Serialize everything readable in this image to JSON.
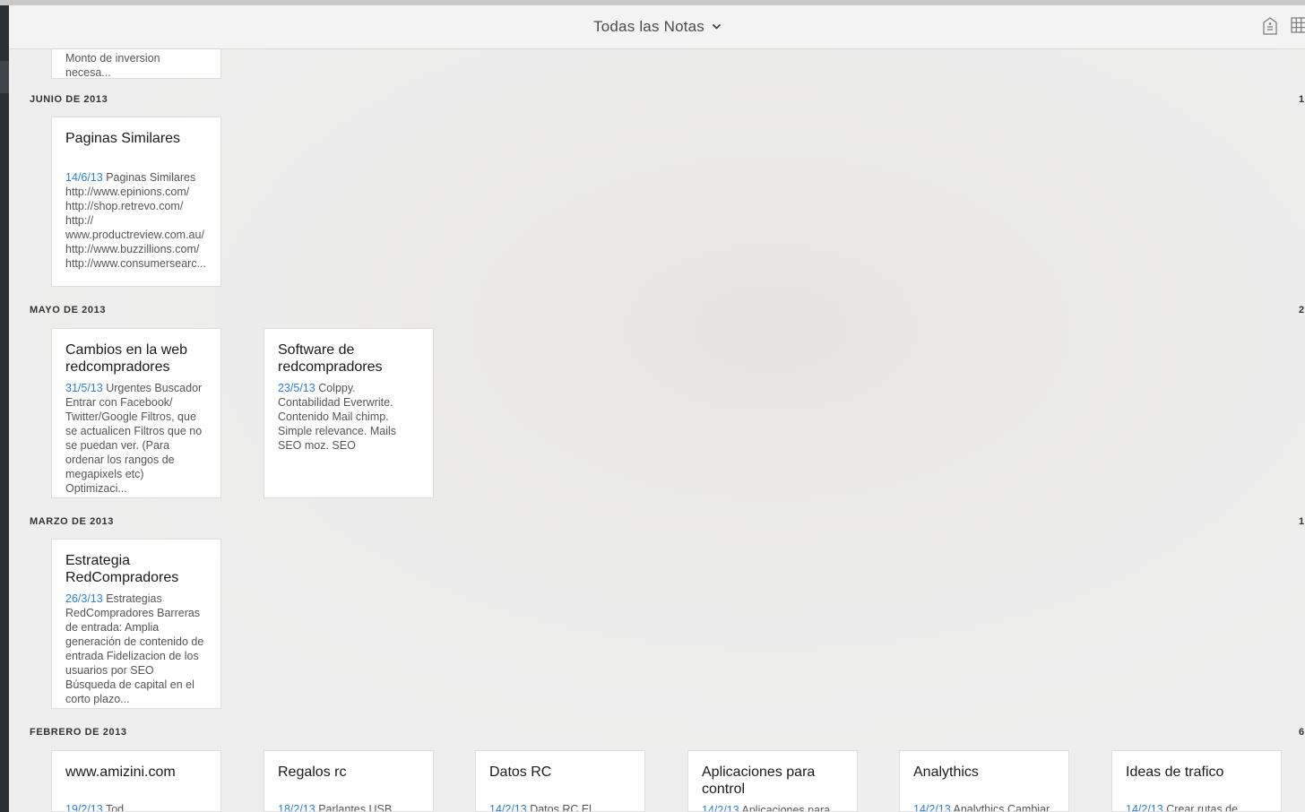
{
  "header": {
    "title": "Todas las Notas"
  },
  "icons": {
    "shortcut": "shortcut-icon",
    "grid": "grid-view-icon",
    "dropdown": "chevron-down-icon"
  },
  "colors": {
    "date_accent": "#2b7fd9",
    "sidebar": "#2b3035"
  },
  "top_partial_note": {
    "body": "Monto de inversion necesa..."
  },
  "sections": [
    {
      "label": "JUNIO DE 2013",
      "count": "1",
      "notes": [
        {
          "title": "Paginas Similares",
          "date": "14/6/13",
          "body": " Paginas Similares http://www.epinions.com/ http://shop.retrevo.com/ http:// www.productreview.com.au/ http://www.buzzillions.com/ http://www.consumersearc..."
        }
      ]
    },
    {
      "label": "MAYO DE 2013",
      "count": "2",
      "notes": [
        {
          "title": "Cambios en la web redcompradores",
          "date": "31/5/13",
          "body": " Urgentes Buscador Entrar con Facebook/ Twitter/Google Filtros, que se actualicen Filtros que no se puedan ver. (Para ordenar los rangos de megapixels etc) Optimizaci..."
        },
        {
          "title": "Software de redcompradores",
          "date": "23/5/13",
          "body": " Colppy. Contabilidad Everwrite. Contenido Mail chimp. Simple relevance. Mails SEO moz. SEO"
        }
      ]
    },
    {
      "label": "MARZO DE 2013",
      "count": "1",
      "notes": [
        {
          "title": "Estrategia RedCompradores",
          "date": "26/3/13",
          "body": " Estrategias RedCompradores Barreras de entrada: Amplia generación de contenido de entrada Fidelizacion de los usuarios por SEO Búsqueda de capital en el corto plazo..."
        }
      ]
    },
    {
      "label": "FEBRERO DE 2013",
      "count": "6",
      "notes": [
        {
          "title": "www.amizini.com",
          "date": "19/2/13",
          "body": " Tod"
        },
        {
          "title": "Regalos rc",
          "date": "18/2/13",
          "body": " Parlantes USB"
        },
        {
          "title": "Datos RC",
          "date": "14/2/13",
          "body": " Datos RC El"
        },
        {
          "title": "Aplicaciones para control",
          "date": "14/2/13",
          "body": " Aplicaciones para"
        },
        {
          "title": "Analythics",
          "date": "14/2/13",
          "body": " Analythics Cambiar"
        },
        {
          "title": "Ideas de trafico",
          "date": "14/2/13",
          "body": " Crear rutas de"
        }
      ]
    }
  ]
}
